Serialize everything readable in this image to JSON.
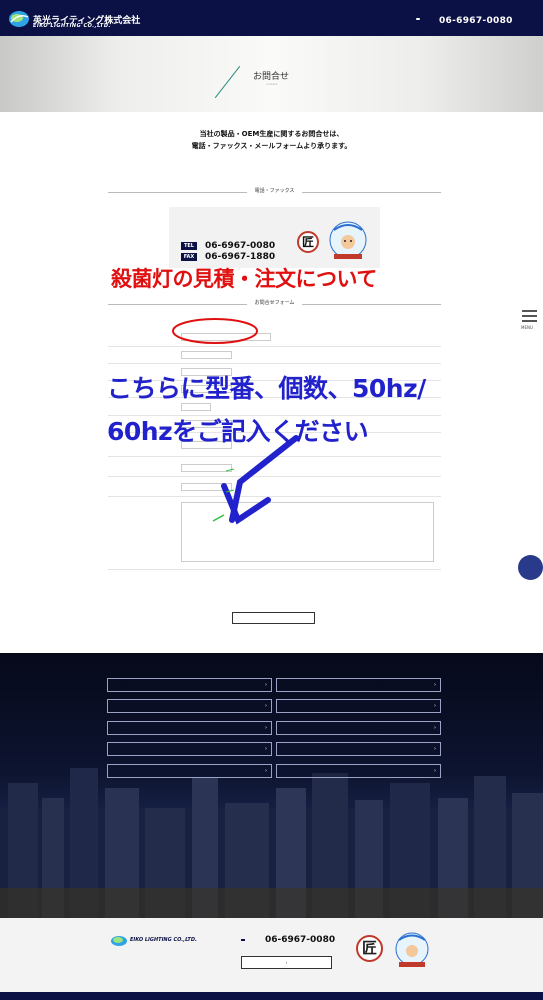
{
  "header": {
    "topbar_text": "",
    "logo_jp": "英光ライティング株式会社",
    "logo_en": "EIKO LIGHTING CO.,LTD.",
    "note": "",
    "tel_badge": "",
    "tel": "06-6967-0080"
  },
  "hero": {
    "title": "お問合せ",
    "subtitle": "contact"
  },
  "intro": {
    "line1": "当社の製品・OEM生産に関するお問合せは、",
    "line2": "電話・ファックス・メールフォームより承ります。",
    "note": "",
    "link": ""
  },
  "phone_section": {
    "title": "電話・ファックス",
    "box_note": "",
    "company": "",
    "address": "",
    "tel_label": "TEL",
    "tel": "06-6967-0080",
    "fax_label": "FAX",
    "fax": "06-6967-1880",
    "takumi": "匠"
  },
  "annotations": {
    "red": "殺菌灯の見積・注文について",
    "blue_line1": "こちらに型番、個数、50hz/",
    "blue_line2": "60hzをご記入ください"
  },
  "form": {
    "title": "お問合せフォーム",
    "required_label": "",
    "fields": [
      {
        "label": "",
        "value": ""
      },
      {
        "label": "",
        "value": ""
      },
      {
        "label": "",
        "value": ""
      },
      {
        "label": "",
        "value": ""
      },
      {
        "label": "",
        "value": ""
      },
      {
        "label": "",
        "value": ""
      },
      {
        "label": "",
        "value": ""
      },
      {
        "label": "",
        "placeholder": ""
      },
      {
        "label": "",
        "placeholder": ""
      },
      {
        "label": "",
        "value": ""
      }
    ],
    "contact_method_label_1": "",
    "contact_method_label_2": "",
    "contact_methods": [
      "",
      "",
      ""
    ],
    "submit": ""
  },
  "side": {
    "menu": "MENU",
    "top": ""
  },
  "footer_nav": [
    {
      "label": ""
    },
    {
      "label": ""
    },
    {
      "label": ""
    },
    {
      "label": ""
    },
    {
      "label": ""
    },
    {
      "label": ""
    },
    {
      "label": ""
    },
    {
      "label": ""
    },
    {
      "label": ""
    },
    {
      "label": ""
    }
  ],
  "footer": {
    "logo_en": "EIKO LIGHTING CO.,LTD.",
    "line1": "",
    "line2": "",
    "address": "",
    "phones": "",
    "note": "",
    "tel_badge": "",
    "tel": "06-6967-0080",
    "form_button": "",
    "takumi": "匠",
    "motto1": "",
    "motto2": "",
    "motto_small": "",
    "copyright": ""
  },
  "colors": {
    "navy": "#0b1144",
    "accent_green": "#2a8c7a",
    "required_red": "#c0392b",
    "annotation_red": "#e01010",
    "annotation_blue": "#2222cc"
  }
}
